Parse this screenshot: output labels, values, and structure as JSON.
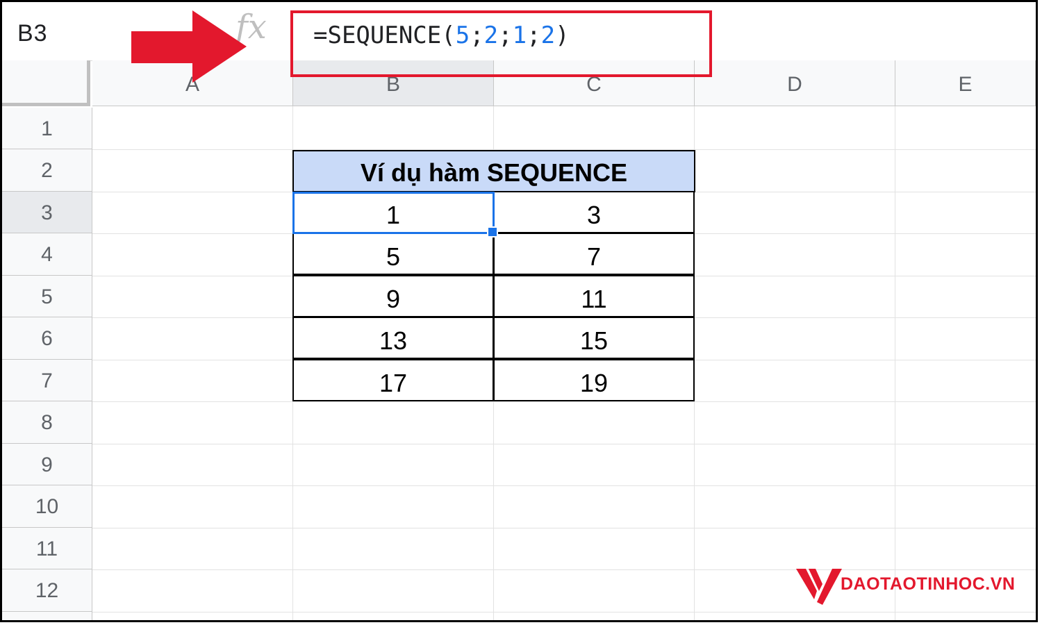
{
  "formula_bar": {
    "name_box": "B3",
    "fx": "fx",
    "formula_prefix": "=SEQUENCE(",
    "args": [
      "5",
      "2",
      "1",
      "2"
    ],
    "separator": ";",
    "formula_suffix": ")"
  },
  "columns": [
    "A",
    "B",
    "C",
    "D",
    "E"
  ],
  "rows": [
    "1",
    "2",
    "3",
    "4",
    "5",
    "6",
    "7",
    "8",
    "9",
    "10",
    "11",
    "12"
  ],
  "selected_cell": {
    "column": "B",
    "row": "3"
  },
  "table": {
    "title": "Ví dụ hàm SEQUENCE",
    "cells": [
      [
        "1",
        "3"
      ],
      [
        "5",
        "7"
      ],
      [
        "9",
        "11"
      ],
      [
        "13",
        "15"
      ],
      [
        "17",
        "19"
      ]
    ]
  },
  "colors": {
    "accent_blue": "#1a73e8",
    "annotation_red": "#e3182d",
    "title_fill": "#c9daf8"
  },
  "logo": {
    "text": "DAOTAOTINHOC.VN"
  }
}
